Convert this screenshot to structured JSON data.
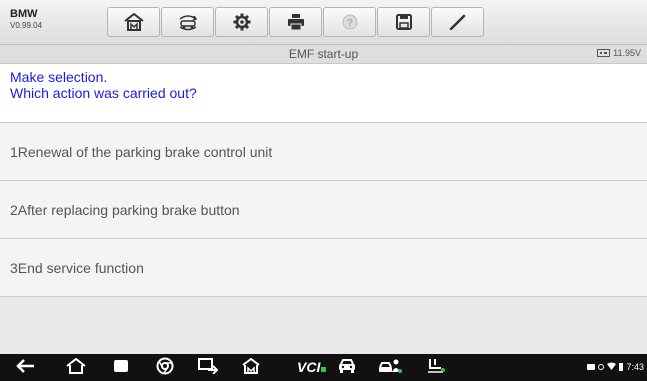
{
  "toolbar": {
    "brand": "BMW",
    "version": "V0.99.04",
    "buttons": [
      {
        "icon": "home-icon"
      },
      {
        "icon": "vehicle-swap-icon"
      },
      {
        "icon": "gear-icon"
      },
      {
        "icon": "printer-icon"
      },
      {
        "icon": "help-icon"
      },
      {
        "icon": "save-icon"
      },
      {
        "icon": "pen-icon"
      }
    ]
  },
  "titlebar": {
    "title": "EMF start-up",
    "battery_voltage": "11.95V"
  },
  "prompt": {
    "line1": "Make selection.",
    "line2": "Which action was carried out?"
  },
  "options": [
    {
      "label": "1Renewal of the parking brake control unit"
    },
    {
      "label": "2After replacing parking brake button"
    },
    {
      "label": "3End service function"
    }
  ],
  "navbar": {
    "vcl_label": "VCI",
    "time": "7:43"
  },
  "colors": {
    "prompt_text": "#1a1adf",
    "option_text": "#555555",
    "navbar_bg": "#111111",
    "connection_green": "#3cc33c"
  }
}
